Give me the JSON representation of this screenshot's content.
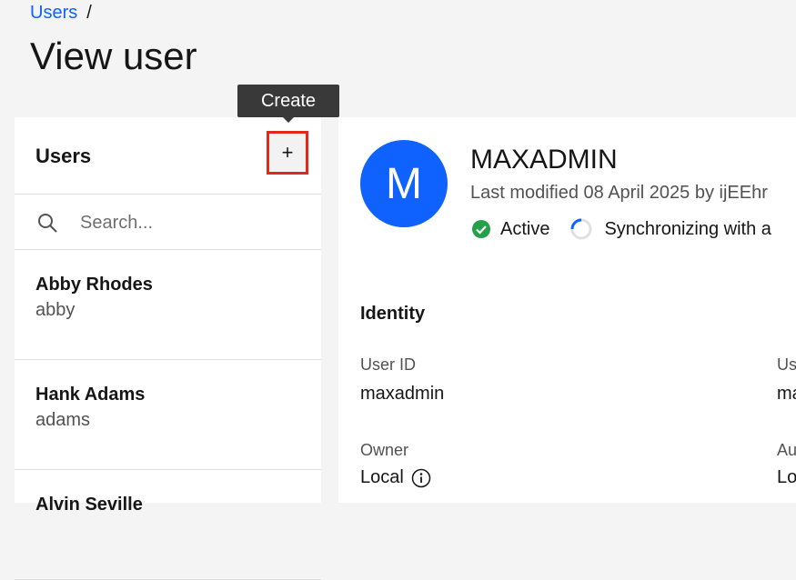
{
  "breadcrumb": {
    "link": "Users",
    "separator": "/"
  },
  "page_title": "View user",
  "tooltip": "Create",
  "users_panel": {
    "title": "Users",
    "create_label": "+",
    "search": {
      "placeholder": "Search...",
      "value": ""
    },
    "users": [
      {
        "name": "Abby Rhodes",
        "username": "abby"
      },
      {
        "name": "Hank Adams",
        "username": "adams"
      },
      {
        "name": "Alvin Seville",
        "username": ""
      }
    ]
  },
  "detail": {
    "avatar_letter": "M",
    "title": "MAXADMIN",
    "modified": "Last modified 08 April 2025 by ijEEhr",
    "status": "Active",
    "sync": "Synchronizing with a",
    "section": "Identity",
    "fields": [
      {
        "label": "User ID",
        "value": "maxadmin"
      },
      {
        "label": "Us",
        "value": "ma"
      },
      {
        "label": "Owner",
        "value": "Local"
      },
      {
        "label": "Au",
        "value": "Lo"
      }
    ]
  },
  "colors": {
    "accent": "#0f62fe",
    "success": "#24a148",
    "highlight": "#e0291b"
  },
  "icons": [
    "search-icon",
    "plus-icon",
    "check-circle-icon",
    "sync-spinner-icon",
    "info-icon"
  ]
}
